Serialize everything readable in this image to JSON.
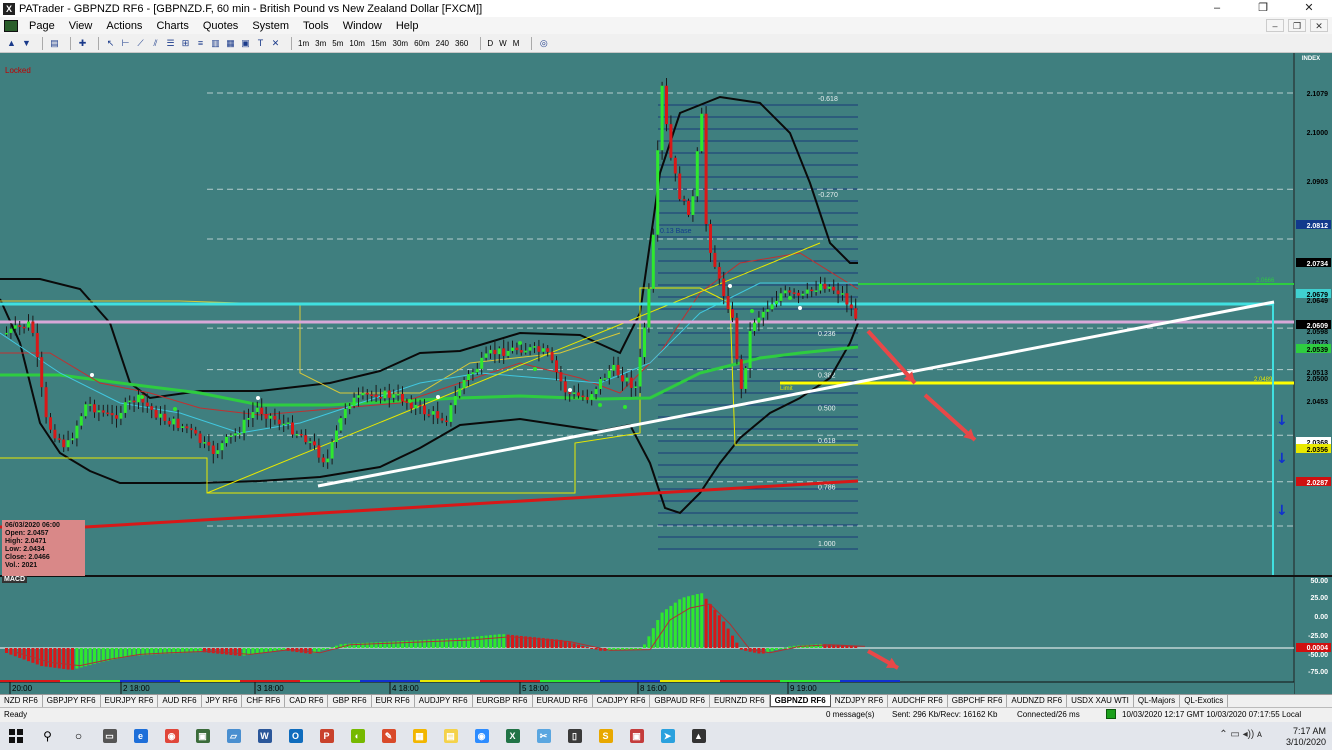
{
  "window": {
    "title": "PATrader - GBPNZD RF6 - [GBPNZD.F, 60 min - British Pound vs New Zealand Dollar [FXCM]]",
    "app_icon_letter": "X",
    "buttons": [
      "–",
      "❐",
      "✕"
    ]
  },
  "menu": [
    "Page",
    "View",
    "Actions",
    "Charts",
    "Quotes",
    "System",
    "Tools",
    "Window",
    "Help"
  ],
  "mdi_buttons": [
    "–",
    "❐",
    "✕"
  ],
  "toolbar": {
    "timeframes": [
      "1m",
      "3m",
      "5m",
      "10m",
      "15m",
      "30m",
      "60m",
      "240",
      "360"
    ],
    "periods": [
      "D",
      "W",
      "M"
    ]
  },
  "chart": {
    "locked_label": "Locked",
    "index_label": "INDEX",
    "fib_labels": [
      "-0.618",
      "-0.270",
      "0.236",
      "0.382",
      "0.500",
      "0.618",
      "0.786",
      "1.000"
    ],
    "base_label": "0.13 Base",
    "limit_label": "Limit",
    "price_labels": [
      "2.1079",
      "2.1000",
      "2.0903",
      "2.0812",
      "2.0734",
      "2.0679",
      "2.0649",
      "2.0609",
      "2.0598",
      "2.0573",
      "2.0539",
      "2.0513",
      "2.0500",
      "2.0453",
      "2.0368",
      "2.0356",
      "2.0287"
    ],
    "price_label_colors": {
      "2.0812": "#123a8c",
      "2.0734": "#000000",
      "2.0679": "#40d0d0",
      "2.0609": "#000000",
      "2.0539": "#2ecc40",
      "2.0368": "#ffffff",
      "2.0356": "#e8e800",
      "2.0287": "#d01010"
    },
    "yellow_level_label": "2.0489",
    "green_level_label": "2.0666",
    "ohlc": {
      "date": "06/03/2020 06:00",
      "open": "Open: 2.0457",
      "high": "High: 2.0471",
      "low": "Low: 2.0434",
      "close": "Close: 2.0466",
      "vol": "Vol.: 2021"
    },
    "time_labels": [
      "20:00",
      "2 18:00",
      "3 18:00",
      "4 18:00",
      "5 18:00",
      "8 16:00",
      "9 19:00"
    ],
    "macd_label": "MACD",
    "macd_axis": [
      "50.00",
      "25.00",
      "0.00",
      "-25.00",
      "-50.00",
      "-75.00"
    ],
    "macd_value": "0.0004",
    "colors": {
      "background": "#3f7f7f",
      "bull": "#2ee82e",
      "bear": "#d81818",
      "trendline_white": "#ffffff",
      "trendline_red": "#d81818",
      "cyan_level": "#40e0e0",
      "pink_level": "#d8a8d8",
      "yellow_level": "#ffff00",
      "green_level": "#2ecc40",
      "arrow": "#e84848"
    }
  },
  "symbol_tabs": [
    "NZD RF6",
    "GBPJPY RF6",
    "EURJPY RF6",
    "AUD RF6",
    "JPY RF6",
    "CHF RF6",
    "CAD RF6",
    "GBP RF6",
    "EUR RF6",
    "AUDJPY RF6",
    "EURGBP RF6",
    "EURAUD RF6",
    "CADJPY RF6",
    "GBPAUD RF6",
    "EURNZD RF6",
    "GBPNZD RF6",
    "NZDJPY RF6",
    "AUDCHF RF6",
    "GBPCHF RF6",
    "AUDNZD RF6",
    "USDX XAU WTI",
    "QL-Majors",
    "QL-Exotics"
  ],
  "active_tab": "GBPNZD RF6",
  "status": {
    "ready": "Ready",
    "messages": "0 message(s)",
    "traffic": "Sent: 296 Kb/Recv: 16162 Kb",
    "connection": "Connected/26 ms",
    "time": "10/03/2020 12:17 GMT  10/03/2020 07:17:55 Local"
  },
  "taskbar": {
    "apps": [
      "Task View",
      "Edge",
      "Chrome",
      "PATrader",
      "Files",
      "Word",
      "Outlook",
      "PowerPoint",
      "Nvidia",
      "Pen",
      "Explorer",
      "Notes",
      "Zoom",
      "Excel",
      "Snip",
      "Notepad",
      "Slides",
      "Calc",
      "Telegram",
      "Photos"
    ],
    "time": "7:17 AM",
    "date": "3/10/2020"
  }
}
